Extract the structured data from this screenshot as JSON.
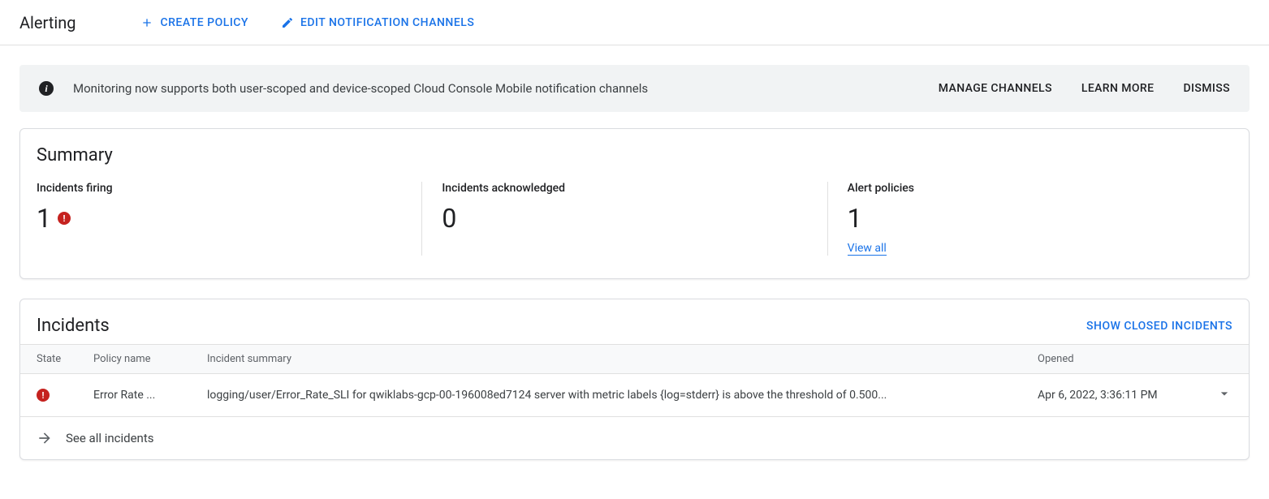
{
  "header": {
    "title": "Alerting",
    "create_policy": "CREATE POLICY",
    "edit_channels": "EDIT NOTIFICATION CHANNELS"
  },
  "banner": {
    "text": "Monitoring now supports both user-scoped and device-scoped Cloud Console Mobile notification channels",
    "manage": "MANAGE CHANNELS",
    "learn": "LEARN MORE",
    "dismiss": "DISMISS"
  },
  "summary": {
    "title": "Summary",
    "firing_label": "Incidents firing",
    "firing_value": "1",
    "ack_label": "Incidents acknowledged",
    "ack_value": "0",
    "policies_label": "Alert policies",
    "policies_value": "1",
    "view_all": "View all"
  },
  "incidents": {
    "title": "Incidents",
    "show_closed": "SHOW CLOSED INCIDENTS",
    "columns": {
      "state": "State",
      "policy": "Policy name",
      "summary": "Incident summary",
      "opened": "Opened"
    },
    "rows": [
      {
        "policy": "Error Rate ...",
        "summary": "logging/user/Error_Rate_SLI for qwiklabs-gcp-00-196008ed7124 server with metric labels {log=stderr} is above the threshold of 0.500...",
        "opened": "Apr 6, 2022, 3:36:11 PM"
      }
    ],
    "see_all": "See all incidents"
  }
}
